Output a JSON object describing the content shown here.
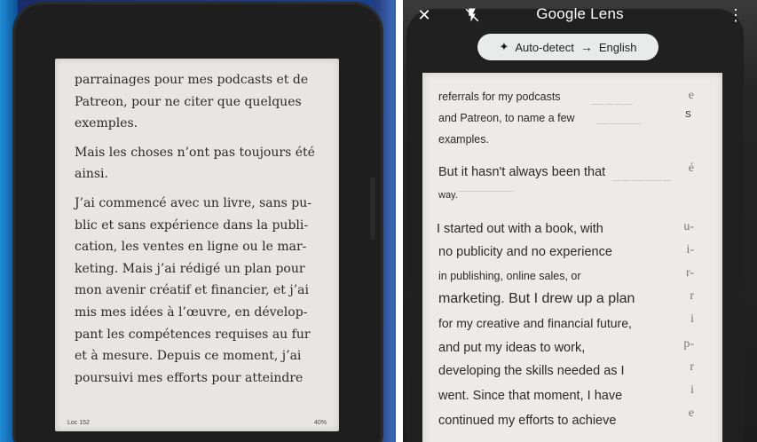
{
  "left": {
    "paragraphs": [
      [
        "parrainages pour mes podcasts et de",
        "Patreon, pour ne citer que quelques",
        "exemples."
      ],
      [
        "Mais les choses n’ont pas toujours été",
        "ainsi."
      ],
      [
        "J’ai commencé avec un livre, sans pu-",
        "blic et sans expérience dans la publi-",
        "cation, les ventes en ligne ou le mar-",
        "keting. Mais j’ai rédigé un plan pour",
        "mon avenir créatif et financier, et j’ai",
        "mis mes idées à l’œuvre, en dévelop-",
        "pant les compétences requises au fur",
        "et à mesure. Depuis ce moment, j’ai",
        "poursuivi mes efforts pour atteindre"
      ]
    ],
    "footer": {
      "location": "Loc 152",
      "percent": "40%"
    }
  },
  "lens": {
    "title": "Google Lens",
    "source_lang": "Auto-detect",
    "target_lang": "English",
    "icons": {
      "close": "close-icon",
      "flash": "flash-off-icon",
      "menu": "more-vert-icon"
    },
    "translation": [
      "referrals for my podcasts",
      "and Patreon, to name a few",
      "examples.",
      "But it hasn't always been that",
      "way.",
      "I started out with a book, with",
      "no publicity and no experience",
      "in publishing, online sales, or",
      "marketing. But I drew up a plan",
      "for my creative and financial future,",
      "and put my ideas to work,",
      "developing the skills needed as I",
      "went. Since that moment, I have",
      "continued my efforts to achieve"
    ],
    "hyphen_marks": [
      "e",
      "é",
      "u-",
      "i-",
      "r-",
      "r",
      "i",
      "p-",
      "r",
      "i",
      "e"
    ],
    "residual_marks": [
      "S"
    ]
  }
}
